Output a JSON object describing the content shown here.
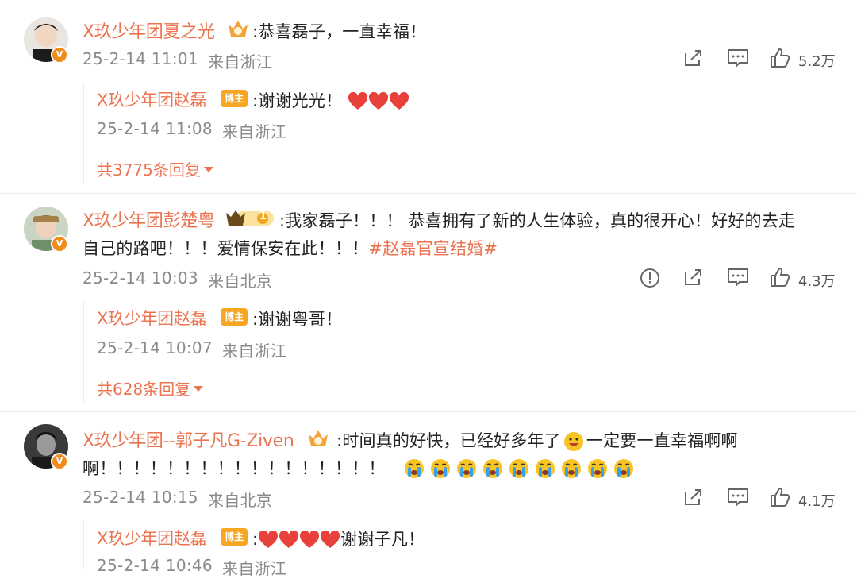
{
  "comments": [
    {
      "author": "X玖少年团夏之光",
      "text": ":恭喜磊子，一直幸福！",
      "time": "25-2-14 11:01",
      "location": "来自浙江",
      "likes": "5.2万",
      "reply": {
        "author": "X玖少年团赵磊",
        "text": ":谢谢光光！",
        "time": "25-2-14 11:08",
        "location": "来自浙江"
      },
      "more_replies": "共3775条回复"
    },
    {
      "author": "X玖少年团彭楚粤",
      "text_line1": ":我家磊子！！！ 恭喜拥有了新的人生体验，真的很开心！好好的去走",
      "text_line2": "自己的路吧！！！爱情保安在此！！！",
      "hashtag": "#赵磊官宣结婚#",
      "time": "25-2-14 10:03",
      "location": "来自北京",
      "likes": "4.3万",
      "reply": {
        "author": "X玖少年团赵磊",
        "text": ":谢谢粤哥！",
        "time": "25-2-14 10:07",
        "location": "来自浙江"
      },
      "more_replies": "共628条回复"
    },
    {
      "author": "X玖少年团--郭子凡G-Ziven",
      "text_line1": ":时间真的好快，已经好多年了",
      "text_line1b": "一定要一直幸福啊啊",
      "text_line2": "啊！！！！！！！！！！！！！！！！！",
      "time": "25-2-14 10:15",
      "location": "来自北京",
      "likes": "4.1万",
      "reply": {
        "author": "X玖少年团赵磊",
        "text_after": "谢谢子凡！",
        "time": "25-2-14 10:46",
        "location": "来自浙江"
      }
    }
  ],
  "badges": {
    "v_mark": "V",
    "king_badge": "博主",
    "level_badge": "1"
  },
  "icons": [
    "share-icon",
    "comment-icon",
    "like-icon",
    "report-icon",
    "heart-emoji",
    "crying-emoji",
    "grin-emoji",
    "fan-crown-badge",
    "verified-v-badge"
  ],
  "colors": {
    "name": "#eb7350",
    "meta": "#8a8a8a",
    "badge": "#f6a623",
    "verified": "#f08b1d",
    "heart": "#e8403a"
  }
}
